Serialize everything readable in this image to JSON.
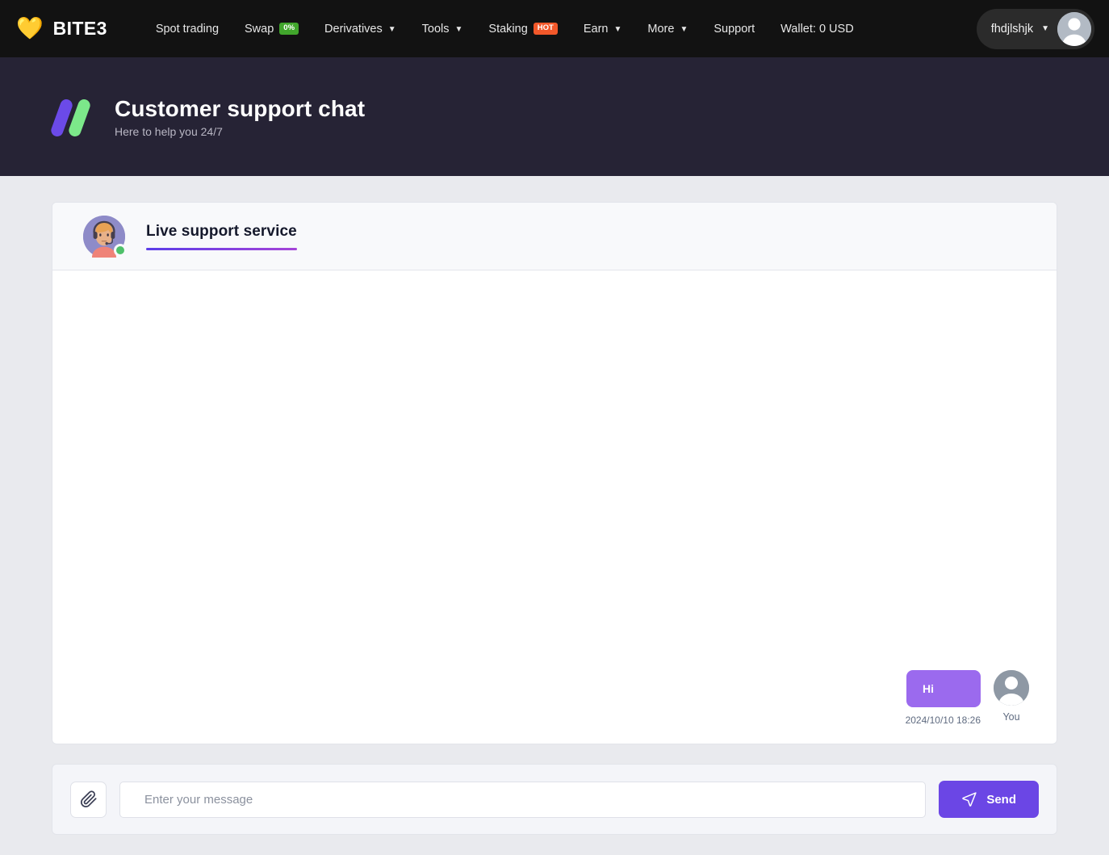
{
  "topnav": {
    "brand": {
      "icon": "yellow-heart-icon",
      "name": "BITE3"
    },
    "items": [
      {
        "label": "Spot trading",
        "caret": false,
        "badge": null
      },
      {
        "label": "Swap",
        "caret": false,
        "badge": "0%",
        "badge_color": "#41a62c"
      },
      {
        "label": "Derivatives",
        "caret": true,
        "badge": null
      },
      {
        "label": "Tools",
        "caret": true,
        "badge": null
      },
      {
        "label": "Staking",
        "caret": false,
        "badge": "HOT",
        "badge_color": "#f2582a"
      },
      {
        "label": "Earn",
        "caret": true,
        "badge": null
      },
      {
        "label": "More",
        "caret": true,
        "badge": null
      },
      {
        "label": "Support",
        "caret": false,
        "badge": null
      },
      {
        "label": "Wallet: 0 USD",
        "caret": false,
        "badge": null
      }
    ],
    "user": {
      "name": "fhdjlshjk",
      "caret": "▾"
    },
    "background": "#121212"
  },
  "page_header": {
    "title": "Customer support chat",
    "subtitle": "Here to help you 24/7",
    "background": "#262335",
    "logo_colors": {
      "purple": "#6b4ae8",
      "green": "#7ce88a"
    }
  },
  "chat": {
    "agent_name": "Live support service",
    "agent_status": "online",
    "underline_gradient": {
      "from": "#5b3de8",
      "to": "#a544d8"
    },
    "messages": [
      {
        "text": "Hi",
        "time": "2024/10/10 18:26",
        "sender_label": "You",
        "side": "right",
        "bubble_color": "#9b6aee"
      }
    ]
  },
  "composer": {
    "attach_icon": "paperclip-icon",
    "placeholder": "Enter your message",
    "value": "",
    "send_label": "Send",
    "send_icon": "paper-plane-icon",
    "send_color": "#6b46e5"
  }
}
